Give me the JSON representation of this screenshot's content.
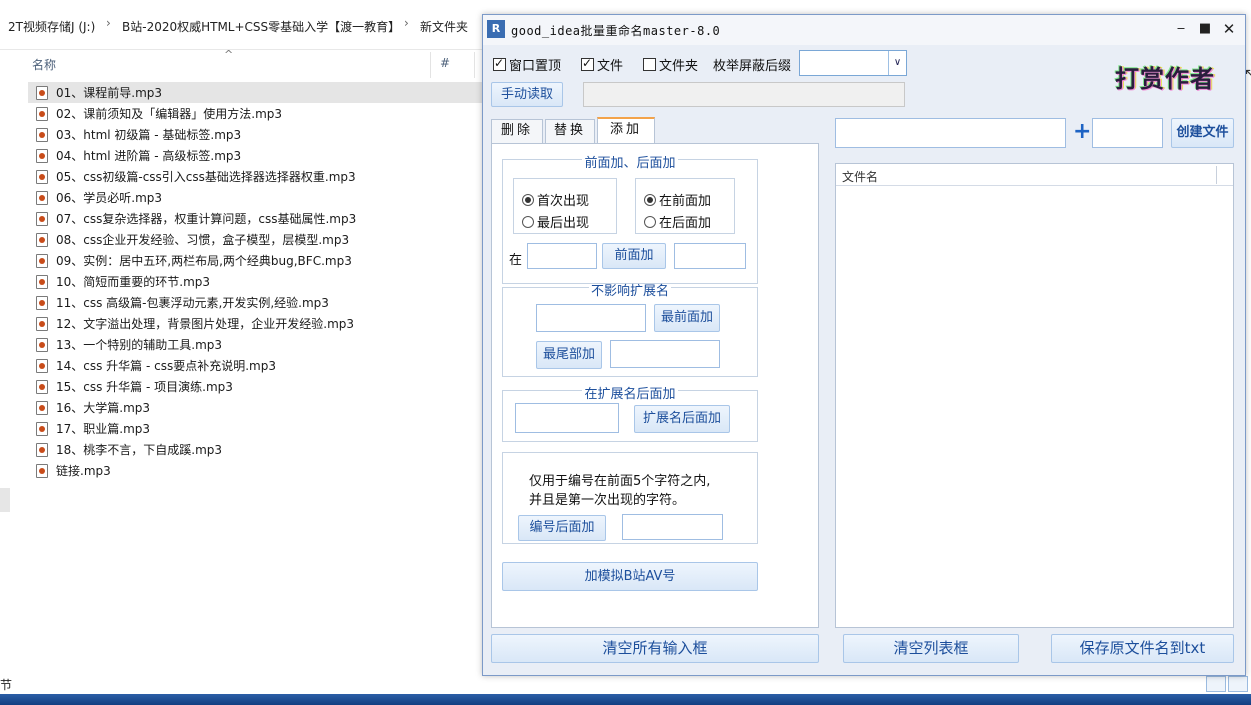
{
  "explorer": {
    "breadcrumb": [
      "2T视频存储J (J:)",
      "B站-2020权威HTML+CSS零基础入学【渡一教育】",
      "新文件夹"
    ],
    "columns": {
      "name": "名称",
      "number": "#"
    },
    "files": [
      "01、课程前导.mp3",
      "02、课前须知及「编辑器」使用方法.mp3",
      "03、html 初级篇 - 基础标签.mp3",
      "04、html 进阶篇 - 高级标签.mp3",
      "05、css初级篇-css引入css基础选择器选择器权重.mp3",
      "06、学员必听.mp3",
      "07、css复杂选择器，权重计算问题，css基础属性.mp3",
      "08、css企业开发经验、习惯，盒子模型，层模型.mp3",
      "09、实例：居中五环,两栏布局,两个经典bug,BFC.mp3",
      "10、简短而重要的环节.mp3",
      "11、css 高级篇-包裹浮动元素,开发实例,经验.mp3",
      "12、文字溢出处理，背景图片处理，企业开发经验.mp3",
      "13、一个特别的辅助工具.mp3",
      "14、css 升华篇 - css要点补充说明.mp3",
      "15、css 升华篇 - 项目演练.mp3",
      "16、大学篇.mp3",
      "17、职业篇.mp3",
      "18、桃李不言，下自成蹊.mp3",
      "链接.mp3"
    ],
    "selected_index": 0,
    "status_left": "节"
  },
  "app": {
    "title": "good_idea批量重命名master-8.0",
    "icon": "app-icon",
    "options": {
      "pin_top": {
        "label": "窗口置顶",
        "checked": true
      },
      "files": {
        "label": "文件",
        "checked": true
      },
      "folders": {
        "label": "文件夹",
        "checked": false
      },
      "suffix_label": "枚举屏蔽后缀",
      "suffix_value": ""
    },
    "logo_text": "打赏作者",
    "manual_read_label": "手动读取",
    "path_value": "",
    "tabs": [
      {
        "label": "删除",
        "active": false
      },
      {
        "label": "替换",
        "active": false
      },
      {
        "label": "添加",
        "active": true
      }
    ],
    "add_panel": {
      "group1": {
        "title": "前面加、后面加",
        "occurrence": [
          {
            "label": "首次出现",
            "on": true
          },
          {
            "label": "最后出现",
            "on": false
          }
        ],
        "position": [
          {
            "label": "在前面加",
            "on": true
          },
          {
            "label": "在后面加",
            "on": false
          }
        ],
        "at_label": "在",
        "front_button": "前面加"
      },
      "group2": {
        "title": "不影响扩展名",
        "front_button": "最前面加",
        "end_button": "最尾部加"
      },
      "group3": {
        "title": "在扩展名后面加",
        "button": "扩展名后面加"
      },
      "group4": {
        "note_line1": "仅用于编号在前面5个字符之内,",
        "note_line2": "并且是第一次出现的字符。",
        "button": "编号后面加"
      },
      "bilibili_button": "加模拟B站AV号"
    },
    "right": {
      "create_button": "创建文件",
      "list_header": "文件名"
    },
    "bottom": {
      "clear_inputs": "清空所有输入框",
      "clear_list": "清空列表框",
      "save_names": "保存原文件名到txt"
    }
  }
}
